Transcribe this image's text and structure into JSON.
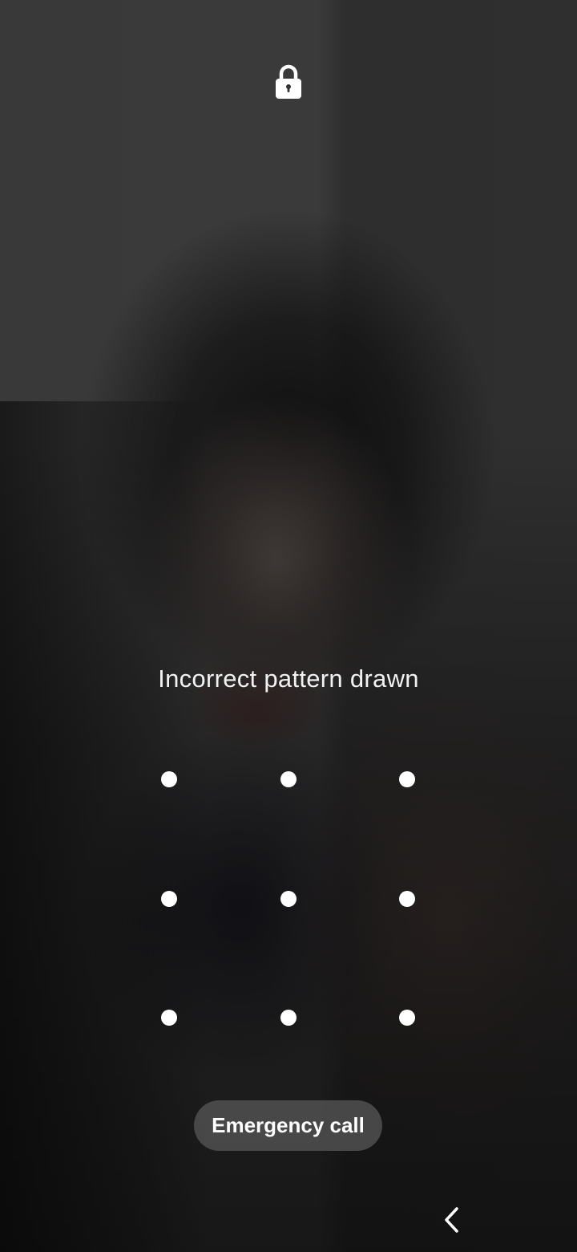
{
  "lockscreen": {
    "lock_icon": "lock-icon",
    "status_message": "Incorrect pattern drawn",
    "pattern_dots": [
      "dot-1",
      "dot-2",
      "dot-3",
      "dot-4",
      "dot-5",
      "dot-6",
      "dot-7",
      "dot-8",
      "dot-9"
    ],
    "emergency_label": "Emergency call"
  },
  "nav_bar": {
    "back_icon": "chevron-left-icon"
  },
  "colors": {
    "text": "#ffffff",
    "button_bg": "#505050",
    "dot": "#ffffff"
  }
}
